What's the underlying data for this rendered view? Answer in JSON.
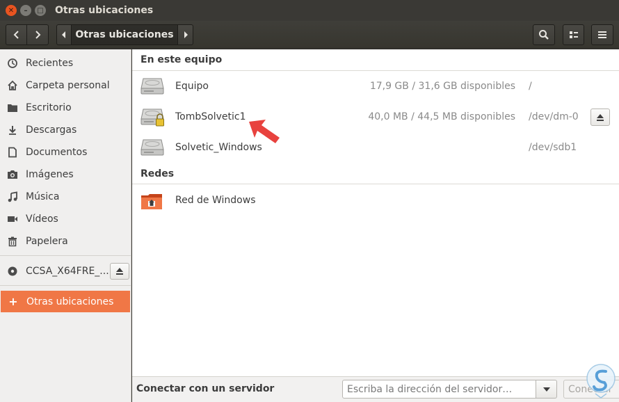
{
  "window": {
    "title": "Otras ubicaciones",
    "controls": [
      "close-icon",
      "minimize-icon",
      "maximize-icon"
    ]
  },
  "header": {
    "path_label": "Otras ubicaciones",
    "icons": [
      "back-arrow-icon",
      "forward-arrow-icon",
      "search-icon",
      "view-options-icon",
      "hamburger-menu-icon"
    ]
  },
  "sidebar": {
    "items": [
      {
        "label": "Recientes",
        "icon": "clock-icon"
      },
      {
        "label": "Carpeta personal",
        "icon": "home-icon"
      },
      {
        "label": "Escritorio",
        "icon": "folder-icon"
      },
      {
        "label": "Descargas",
        "icon": "download-icon"
      },
      {
        "label": "Documentos",
        "icon": "document-icon"
      },
      {
        "label": "Imágenes",
        "icon": "camera-icon"
      },
      {
        "label": "Música",
        "icon": "music-note-icon"
      },
      {
        "label": "Vídeos",
        "icon": "video-icon"
      },
      {
        "label": "Papelera",
        "icon": "trash-icon"
      }
    ],
    "device": {
      "label": "CCSA_X64FRE_...",
      "icon": "optical-disc-icon"
    },
    "other_locations": {
      "label": "Otras ubicaciones",
      "icon": "plus-icon",
      "accent": "#f07746"
    }
  },
  "main": {
    "section_computer": "En este equipo",
    "drives": [
      {
        "name": "Equipo",
        "space": "17,9 GB / 31,6 GB disponibles",
        "mount": "/",
        "locked": false,
        "ejectable": false
      },
      {
        "name": "TombSolvetic1",
        "space": "40,0 MB / 44,5 MB disponibles",
        "mount": "/dev/dm-0",
        "locked": true,
        "ejectable": true
      },
      {
        "name": "Solvetic_Windows",
        "space": "",
        "mount": "/dev/sdb1",
        "locked": false,
        "ejectable": false
      }
    ],
    "section_networks": "Redes",
    "networks": [
      {
        "name": "Red de Windows",
        "icon": "network-folder-icon"
      }
    ],
    "annotation_color": "#e8423e"
  },
  "footer": {
    "connect_label": "Conectar con un servidor",
    "server_placeholder": "Escriba la dirección del servidor…",
    "connect_button": "Conectar"
  }
}
